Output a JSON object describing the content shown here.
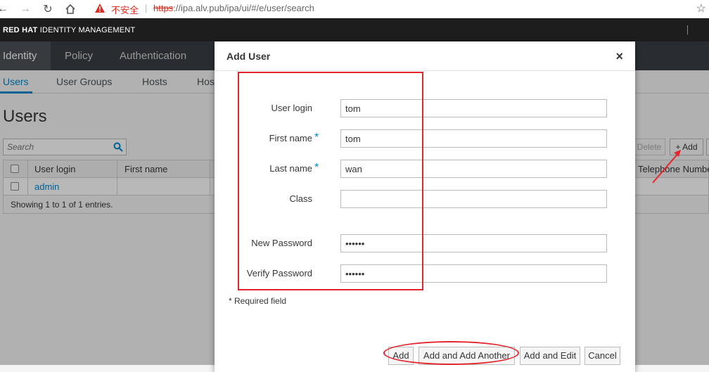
{
  "browser": {
    "security_label": "不安全",
    "url_scheme": "https",
    "url_rest": "://ipa.alv.pub/ipa/ui/#/e/user/search",
    "nav_icons": [
      "back-icon",
      "forward-icon",
      "reload-icon",
      "home-icon",
      "warning-icon",
      "star-icon"
    ]
  },
  "masthead": {
    "brand_bold": "RED HAT",
    "brand_light": " IDENTITY MANAGEMENT"
  },
  "primary_nav": [
    "Identity",
    "Policy",
    "Authentication"
  ],
  "secondary_nav": [
    "Users",
    "User Groups",
    "Hosts",
    "Hos"
  ],
  "page": {
    "title": "Users",
    "search_placeholder": "Search",
    "delete_label": "Delete",
    "add_label": "+ Add"
  },
  "table": {
    "headers": [
      "User login",
      "First name",
      "Telephone Number"
    ],
    "rows": [
      {
        "login": "admin",
        "first_name": ""
      }
    ],
    "footer": "Showing 1 to 1 of 1 entries."
  },
  "dialog": {
    "title": "Add User",
    "close": "×",
    "fields": [
      {
        "label": "User login",
        "value": "tom",
        "required": false
      },
      {
        "label": "First name",
        "value": "tom",
        "required": true
      },
      {
        "label": "Last name",
        "value": "wan",
        "required": true
      },
      {
        "label": "Class",
        "value": "",
        "required": false
      },
      {
        "label": "New Password",
        "value": "••••••",
        "required": false
      },
      {
        "label": "Verify Password",
        "value": "••••••",
        "required": false
      }
    ],
    "required_note": "* Required field",
    "required_marker": "*",
    "buttons": [
      "Add",
      "Add and Add Another",
      "Add and Edit",
      "Cancel"
    ]
  },
  "colors": {
    "accent": "#0088ce",
    "annotation": "#e3262c",
    "masthead": "#1d1d1d",
    "nav": "#393f44"
  }
}
